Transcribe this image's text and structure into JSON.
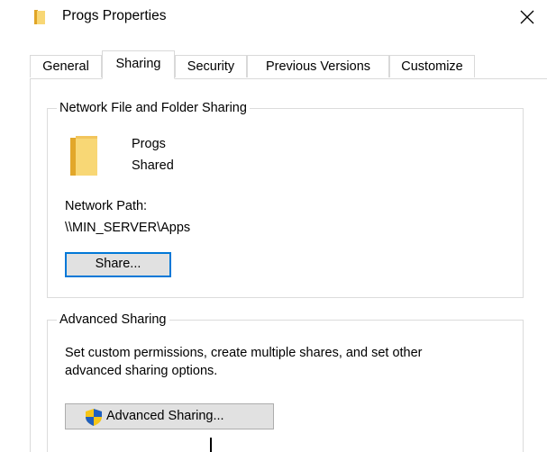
{
  "window": {
    "title": "Progs Properties",
    "icon": "folder-icon",
    "close_icon": "close-icon"
  },
  "tabs": [
    {
      "label": "General",
      "active": false
    },
    {
      "label": "Sharing",
      "active": true
    },
    {
      "label": "Security",
      "active": false
    },
    {
      "label": "Previous Versions",
      "active": false
    },
    {
      "label": "Customize",
      "active": false
    }
  ],
  "network_sharing": {
    "group_label": "Network File and Folder Sharing",
    "folder_name": "Progs",
    "folder_status": "Shared",
    "path_label": "Network Path:",
    "path_value": "\\\\MIN_SERVER\\Apps",
    "share_button": "Share..."
  },
  "advanced_sharing": {
    "group_label": "Advanced Sharing",
    "description_line1": "Set custom permissions, create multiple shares, and set other",
    "description_line2": "advanced sharing options.",
    "button_label": "Advanced Sharing...",
    "button_icon": "uac-shield-icon"
  },
  "colors": {
    "accent": "#0078d7",
    "folder": "#f8d775",
    "button_face": "#e1e1e1",
    "border": "#dcdcdc"
  }
}
